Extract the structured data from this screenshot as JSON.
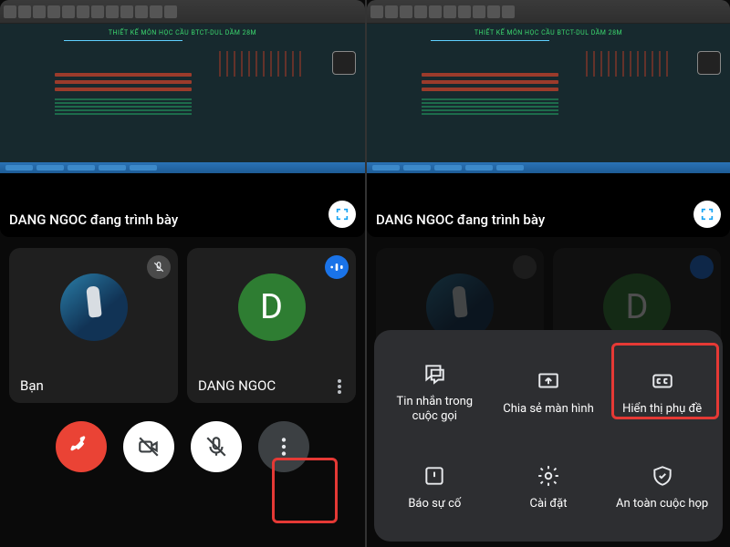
{
  "shared": {
    "presenting_label": "DANG NGOC đang trình bày",
    "drawing_title": "THIẾT KẾ MÔN HỌC CẦU BTCT-DUL DẦM 28M"
  },
  "left": {
    "tiles": [
      {
        "name": "Bạn",
        "avatar_kind": "photo",
        "mic": "muted"
      },
      {
        "name": "DANG NGOC",
        "avatar_kind": "letter",
        "avatar_letter": "D",
        "mic": "active"
      }
    ]
  },
  "sheet": {
    "items": [
      {
        "label": "Tin nhắn trong cuộc gọi",
        "icon": "chat"
      },
      {
        "label": "Chia sẻ màn hình",
        "icon": "share-screen"
      },
      {
        "label": "Hiển thị phụ đề",
        "icon": "cc",
        "highlight": true
      },
      {
        "label": "Báo sự cố",
        "icon": "report"
      },
      {
        "label": "Cài đặt",
        "icon": "settings"
      },
      {
        "label": "An toàn cuộc họp",
        "icon": "shield"
      }
    ]
  }
}
